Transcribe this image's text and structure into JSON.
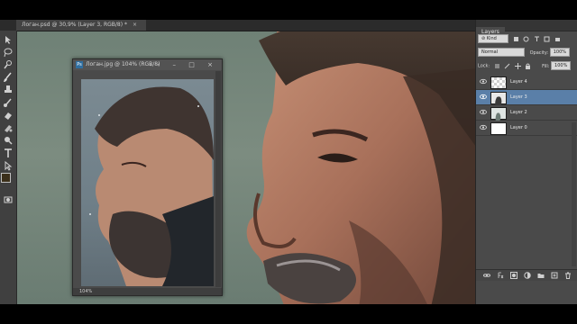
{
  "app": {
    "document_tab": "Логан.psd @ 30,9% (Layer 3, RGB/8) *",
    "tab_close": "×"
  },
  "toolbar": {
    "tools": [
      "move-tool",
      "lasso-tool",
      "quick-select-tool",
      "brush-tool",
      "clone-tool",
      "history-brush-tool",
      "eraser-tool",
      "gradient-tool",
      "dodge-tool",
      "pen-tool",
      "type-tool",
      "path-select-tool",
      "shape-tool",
      "hand-tool",
      "zoom-tool"
    ],
    "foreground_color": "#3b2f1a",
    "background_color": "#d7c9a3"
  },
  "reference_window": {
    "ps_badge": "Ps",
    "title": "Логан.jpg @ 104% (RGB/8)",
    "controls": "‹‹ – □ ×",
    "zoom": "104%"
  },
  "layers_panel": {
    "tab": "Layers",
    "filter_kind": "⊘ Kind",
    "blend_mode": "Normal",
    "opacity_label": "Opacity:",
    "opacity_value": "100%",
    "lock_label": "Lock:",
    "fill_label": "Fill:",
    "fill_value": "100%",
    "layers": [
      {
        "name": "Layer 4",
        "visible": true,
        "selected": false,
        "thumb": "checker"
      },
      {
        "name": "Layer 3",
        "visible": true,
        "selected": true,
        "thumb": "figure"
      },
      {
        "name": "Layer 2",
        "visible": true,
        "selected": false,
        "thumb": "figure-light"
      },
      {
        "name": "Layer 0",
        "visible": true,
        "selected": false,
        "thumb": "white"
      }
    ],
    "footer_icons": [
      "link-layers-icon",
      "fx-icon",
      "layer-mask-icon",
      "adjustment-layer-icon",
      "new-group-icon",
      "new-layer-icon",
      "trash-icon"
    ]
  },
  "colors": {
    "selection": "#5a7fa8",
    "panel_bg": "#4a4a4a",
    "canvas_bg": "#75867b"
  }
}
